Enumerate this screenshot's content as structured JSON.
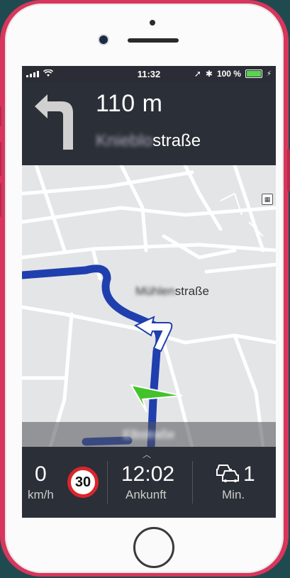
{
  "status_bar": {
    "time": "11:32",
    "battery_text": "100 %"
  },
  "guidance": {
    "distance": "110 m",
    "street_blurred_part": "Knieblo",
    "street_suffix": "straße"
  },
  "map": {
    "street_label_blurred_part": "Mühlen",
    "street_label_suffix": "straße",
    "current_street_blurred": "Elbstraße"
  },
  "bottom_bar": {
    "speed_value": "0",
    "speed_unit": "km/h",
    "speed_limit": "30",
    "arrival_time": "12:02",
    "arrival_label": "Ankunft",
    "traffic_delay": "1",
    "traffic_unit": "Min."
  },
  "colors": {
    "route": "#1f3fae",
    "header_bg": "#2b2f37",
    "battery": "#58d44e",
    "limit_ring": "#d9262c",
    "position_marker": "#43c22a"
  },
  "icons": {
    "turn": "turn-left-arrow-icon",
    "traffic": "cars-traffic-icon",
    "layers": "map-layers-icon"
  }
}
